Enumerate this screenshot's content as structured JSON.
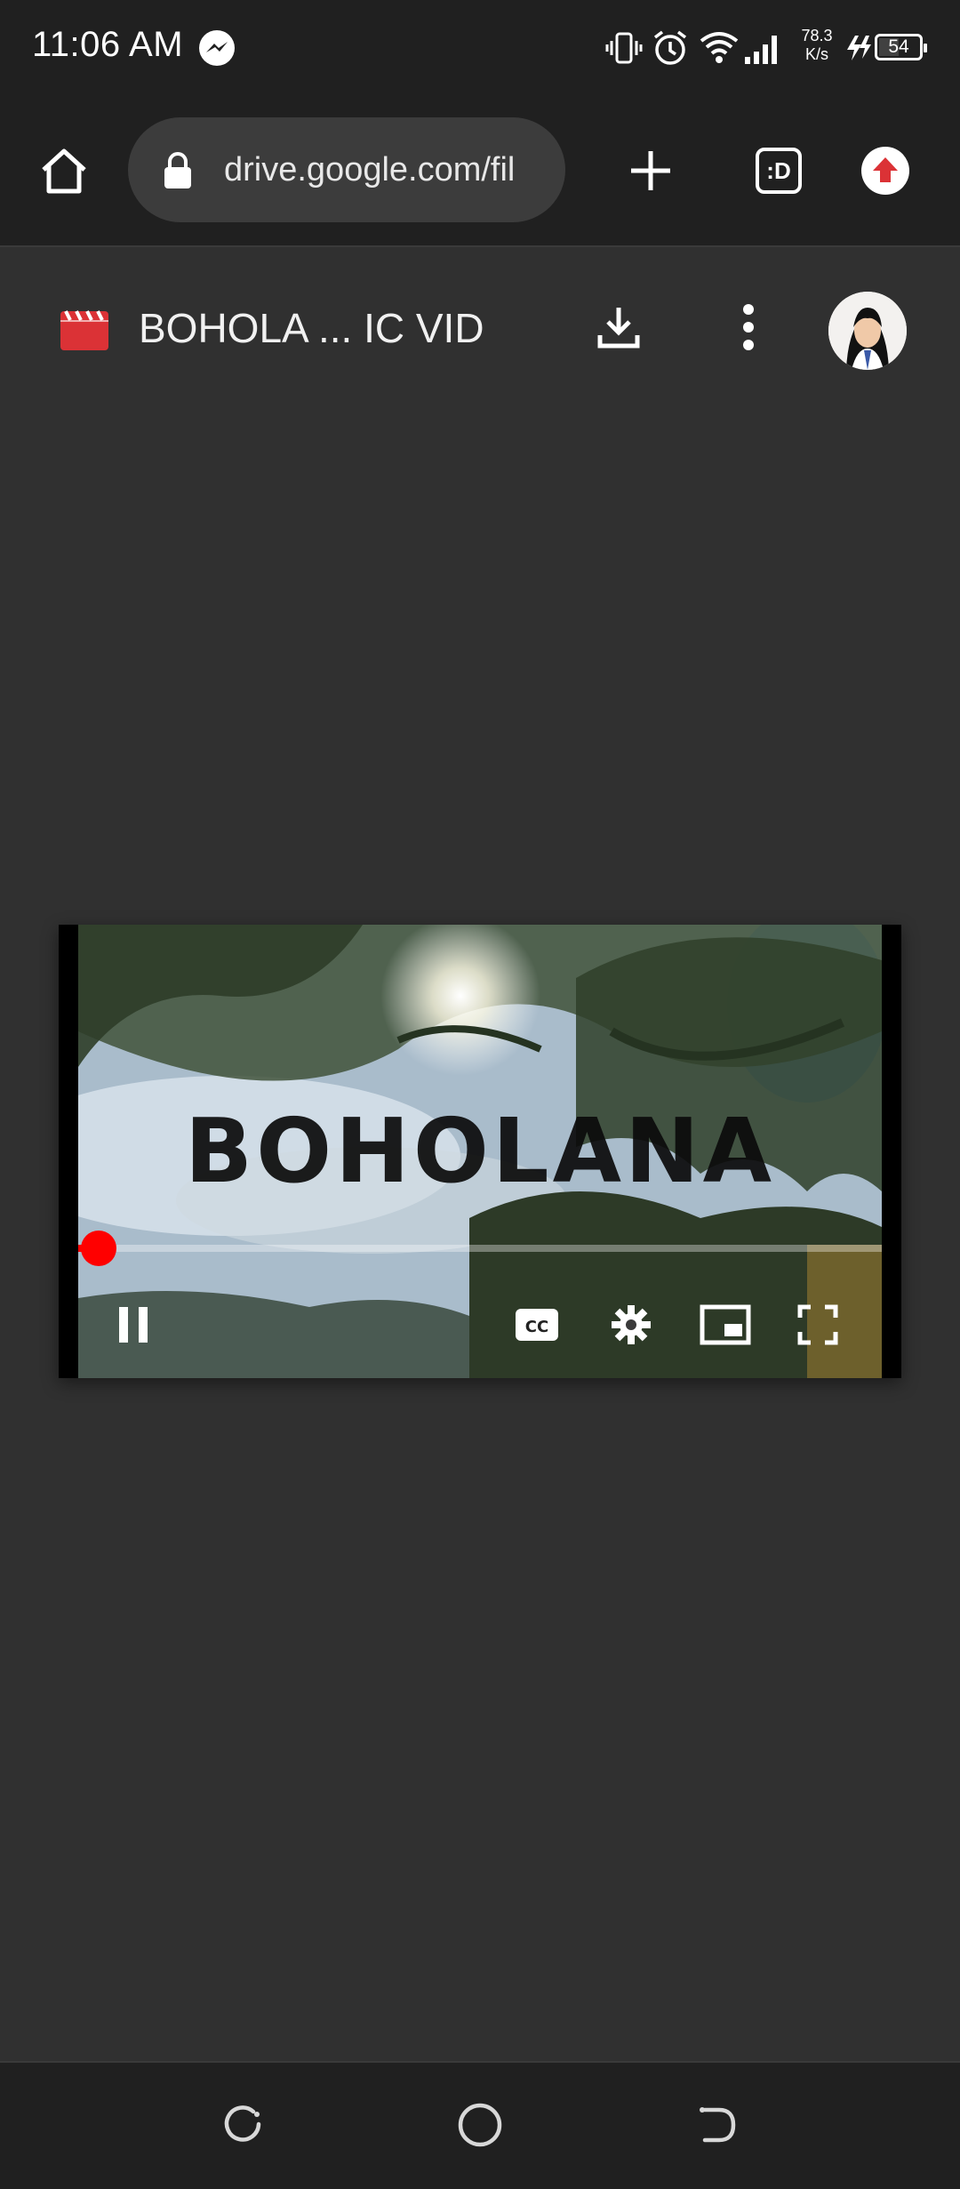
{
  "status_bar": {
    "time": "11:06 AM",
    "net_speed_value": "78.3",
    "net_speed_unit": "K/s",
    "battery_percent": "54",
    "icons": [
      "messenger-icon",
      "vibrate-icon",
      "alarm-icon",
      "wifi-icon",
      "signal-icon",
      "charging-icon",
      "battery-icon"
    ]
  },
  "browser": {
    "url": "drive.google.com/fil",
    "tab_count": ":D",
    "icons": [
      "home-icon",
      "lock-icon",
      "new-tab-icon",
      "update-icon"
    ]
  },
  "drive": {
    "file_title": "BOHOLA ... IC VID",
    "icons": [
      "video-file-icon",
      "download-icon",
      "more-vert-icon",
      "avatar"
    ]
  },
  "video": {
    "overlay_title": "BOHOLANA",
    "progress": 0.025,
    "icons": [
      "pause-icon",
      "captions-icon",
      "settings-icon",
      "miniplayer-icon",
      "fullscreen-icon"
    ]
  },
  "nav": {
    "icons": [
      "recents-icon",
      "home-circle-icon",
      "back-icon"
    ]
  },
  "colors": {
    "page_bg": "#303030",
    "bar_bg": "#202020",
    "url_pill": "#3c3c3c",
    "accent_red": "#ff0000",
    "drive_video_red": "#db3236"
  }
}
